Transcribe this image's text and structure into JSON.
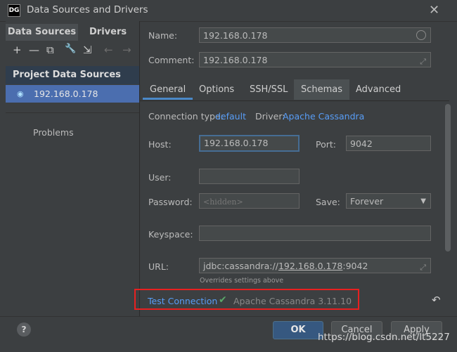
{
  "window": {
    "logo": "DG",
    "title": "Data Sources and Drivers",
    "close": "✕"
  },
  "left": {
    "tabs": [
      "Data Sources",
      "Drivers"
    ],
    "toolbar": [
      "+",
      "—",
      "⧉",
      "🔧",
      "⇲",
      "←",
      "→"
    ],
    "section_header": "Project Data Sources",
    "item": "192.168.0.178",
    "problems": "Problems"
  },
  "form": {
    "name_label": "Name:",
    "name_value": "192.168.0.178",
    "comment_label": "Comment:",
    "comment_value": "192.168.0.178",
    "tabs": [
      "General",
      "Options",
      "SSH/SSL",
      "Schemas",
      "Advanced"
    ],
    "conn_type_label": "Connection type:",
    "conn_type_value": "default",
    "driver_label": "Driver:",
    "driver_value": "Apache Cassandra",
    "host_label": "Host:",
    "host_value": "192.168.0.178",
    "port_label": "Port:",
    "port_value": "9042",
    "user_label": "User:",
    "user_value": "",
    "password_label": "Password:",
    "password_placeholder": "<hidden>",
    "save_label": "Save:",
    "save_value": "Forever",
    "keyspace_label": "Keyspace:",
    "keyspace_value": "",
    "url_label": "URL:",
    "url_prefix": "jdbc:cassandra://",
    "url_host": "192.168.0.178",
    "url_suffix": ":9042",
    "url_note": "Overrides settings above",
    "test_connection": "Test Connection",
    "test_result": "Apache Cassandra 3.11.10"
  },
  "buttons": {
    "help": "?",
    "ok": "OK",
    "cancel": "Cancel",
    "apply": "Apply"
  },
  "watermark": "https://blog.csdn.net/lt5227",
  "colors": {
    "accent": "#4b6eaf",
    "link": "#589df6",
    "highlight_box": "#e82020",
    "success": "#59a869"
  }
}
